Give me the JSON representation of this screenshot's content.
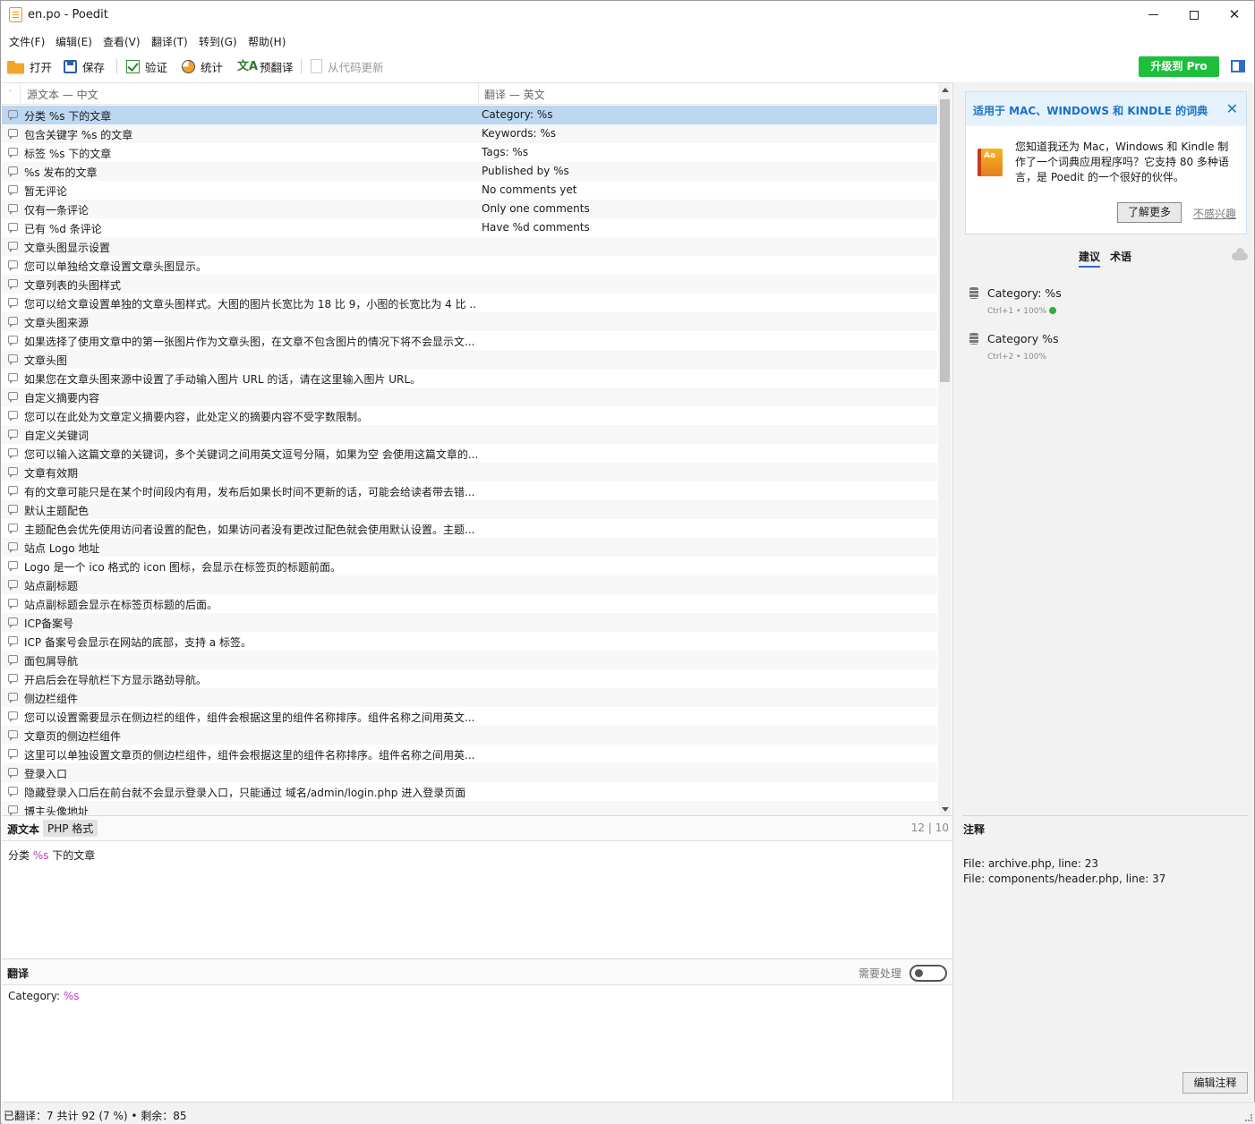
{
  "window": {
    "title": "en.po - Poedit",
    "min_icon": "minimize-icon",
    "max_icon": "maximize-icon",
    "close_glyph": "✕"
  },
  "menu": [
    "文件(F)",
    "编辑(E)",
    "查看(V)",
    "翻译(T)",
    "转到(G)",
    "帮助(H)"
  ],
  "toolbar": {
    "open": "打开",
    "save": "保存",
    "validate": "验证",
    "stats": "统计",
    "pretranslate": "预翻译",
    "update_from_code": "从代码更新",
    "upgrade_pro": "升级到 Pro"
  },
  "list": {
    "header_source": "源文本 — 中文",
    "header_translation": "翻译 — 英文",
    "rows": [
      {
        "src": "分类 %s 下的文章",
        "trans": "Category: %s",
        "selected": true
      },
      {
        "src": "包含关键字 %s 的文章",
        "trans": "Keywords: %s"
      },
      {
        "src": "标签 %s 下的文章",
        "trans": "Tags: %s"
      },
      {
        "src": "%s 发布的文章",
        "trans": "Published by %s"
      },
      {
        "src": "暂无评论",
        "trans": "No comments yet"
      },
      {
        "src": "仅有一条评论",
        "trans": "Only one comments"
      },
      {
        "src": "已有 %d 条评论",
        "trans": "Have %d comments"
      },
      {
        "src": "文章头图显示设置",
        "trans": ""
      },
      {
        "src": "您可以单独给文章设置文章头图显示。",
        "trans": ""
      },
      {
        "src": "文章列表的头图样式",
        "trans": ""
      },
      {
        "src": "您可以给文章设置单独的文章头图样式。大图的图片长宽比为 18 比 9，小图的长宽比为 4 比 ...",
        "trans": ""
      },
      {
        "src": "文章头图来源",
        "trans": ""
      },
      {
        "src": "如果选择了使用文章中的第一张图片作为文章头图，在文章不包含图片的情况下将不会显示文...",
        "trans": ""
      },
      {
        "src": "文章头图",
        "trans": ""
      },
      {
        "src": "如果您在文章头图来源中设置了手动输入图片 URL 的话，请在这里输入图片 URL。",
        "trans": ""
      },
      {
        "src": "自定义摘要内容",
        "trans": ""
      },
      {
        "src": "您可以在此处为文章定义摘要内容，此处定义的摘要内容不受字数限制。",
        "trans": ""
      },
      {
        "src": "自定义关键词",
        "trans": ""
      },
      {
        "src": "您可以输入这篇文章的关键词，多个关键词之间用英文逗号分隔，如果为空 会使用这篇文章的...",
        "trans": ""
      },
      {
        "src": "文章有效期",
        "trans": ""
      },
      {
        "src": "有的文章可能只是在某个时间段内有用，发布后如果长时间不更新的话，可能会给读者带去错...",
        "trans": ""
      },
      {
        "src": "默认主题配色",
        "trans": ""
      },
      {
        "src": "主题配色会优先使用访问者设置的配色，如果访问者没有更改过配色就会使用默认设置。主题...",
        "trans": ""
      },
      {
        "src": "站点 Logo 地址",
        "trans": ""
      },
      {
        "src": "Logo 是一个 ico 格式的 icon 图标，会显示在标签页的标题前面。",
        "trans": ""
      },
      {
        "src": "站点副标题",
        "trans": ""
      },
      {
        "src": "站点副标题会显示在标签页标题的后面。",
        "trans": ""
      },
      {
        "src": "ICP备案号",
        "trans": ""
      },
      {
        "src": "ICP 备案号会显示在网站的底部，支持 a 标签。",
        "trans": ""
      },
      {
        "src": "面包屑导航",
        "trans": ""
      },
      {
        "src": "开启后会在导航栏下方显示路劲导航。",
        "trans": ""
      },
      {
        "src": "侧边栏组件",
        "trans": ""
      },
      {
        "src": "您可以设置需要显示在侧边栏的组件，组件会根据这里的组件名称排序。组件名称之间用英文...",
        "trans": ""
      },
      {
        "src": "文章页的侧边栏组件",
        "trans": ""
      },
      {
        "src": "这里可以单独设置文章页的侧边栏组件，组件会根据这里的组件名称排序。组件名称之间用英...",
        "trans": ""
      },
      {
        "src": "登录入口",
        "trans": ""
      },
      {
        "src": "隐藏登录入口后在前台就不会显示登录入口，只能通过 域名/admin/login.php 进入登录页面",
        "trans": ""
      },
      {
        "src": "博主头像地址",
        "trans": ""
      }
    ]
  },
  "source_panel": {
    "label": "源文本",
    "format_badge": "PHP 格式",
    "counter": "12 | 10",
    "text_before": "分类 ",
    "text_placeholder": "%s",
    "text_after": " 下的文章"
  },
  "translation_panel": {
    "label": "翻译",
    "fuzzy_label": "需要处理",
    "fuzzy_on": false,
    "text_before": "Category: ",
    "text_placeholder": "%s"
  },
  "sidebar": {
    "promo_title": "适用于 MAC、WINDOWS 和 KINDLE 的词典",
    "promo_body": "您知道我还为 Mac，Windows 和 Kindle 制作了一个词典应用程序吗？它支持 80 多种语言，是 Poedit 的一个很好的伙伴。",
    "promo_learn_more": "了解更多",
    "promo_dismiss": "不感兴趣",
    "tab_suggestions": "建议",
    "tab_terms": "术语",
    "suggestions": [
      {
        "text": "Category: %s",
        "meta": "Ctrl+1 • 100%",
        "exact": true
      },
      {
        "text": "Category %s",
        "meta": "Ctrl+2 • 100%",
        "exact": false
      }
    ],
    "notes_label": "注释",
    "notes": [
      "File: archive.php, line: 23",
      "File: components/header.php, line: 37"
    ],
    "edit_notes_button": "编辑注释"
  },
  "status": {
    "text": "已翻译：7 共计 92 (7 %) • 剩余：85"
  }
}
